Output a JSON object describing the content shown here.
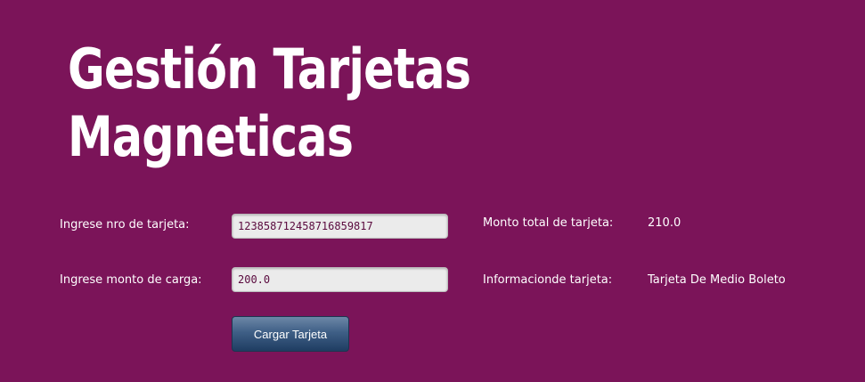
{
  "page": {
    "title_line1": "Gestión Tarjetas",
    "title_line2": "Magneticas"
  },
  "form": {
    "card_number_label": "Ingrese nro de tarjeta:",
    "card_number_value": "123858712458716859817",
    "amount_label": "Ingrese monto de carga:",
    "amount_value": "200.0",
    "submit_label": "Cargar Tarjeta"
  },
  "info": {
    "total_label": "Monto total de tarjeta:",
    "total_value": "210.0",
    "type_label": "Informacionde tarjeta:",
    "type_value": "Tarjeta De Medio Boleto"
  }
}
